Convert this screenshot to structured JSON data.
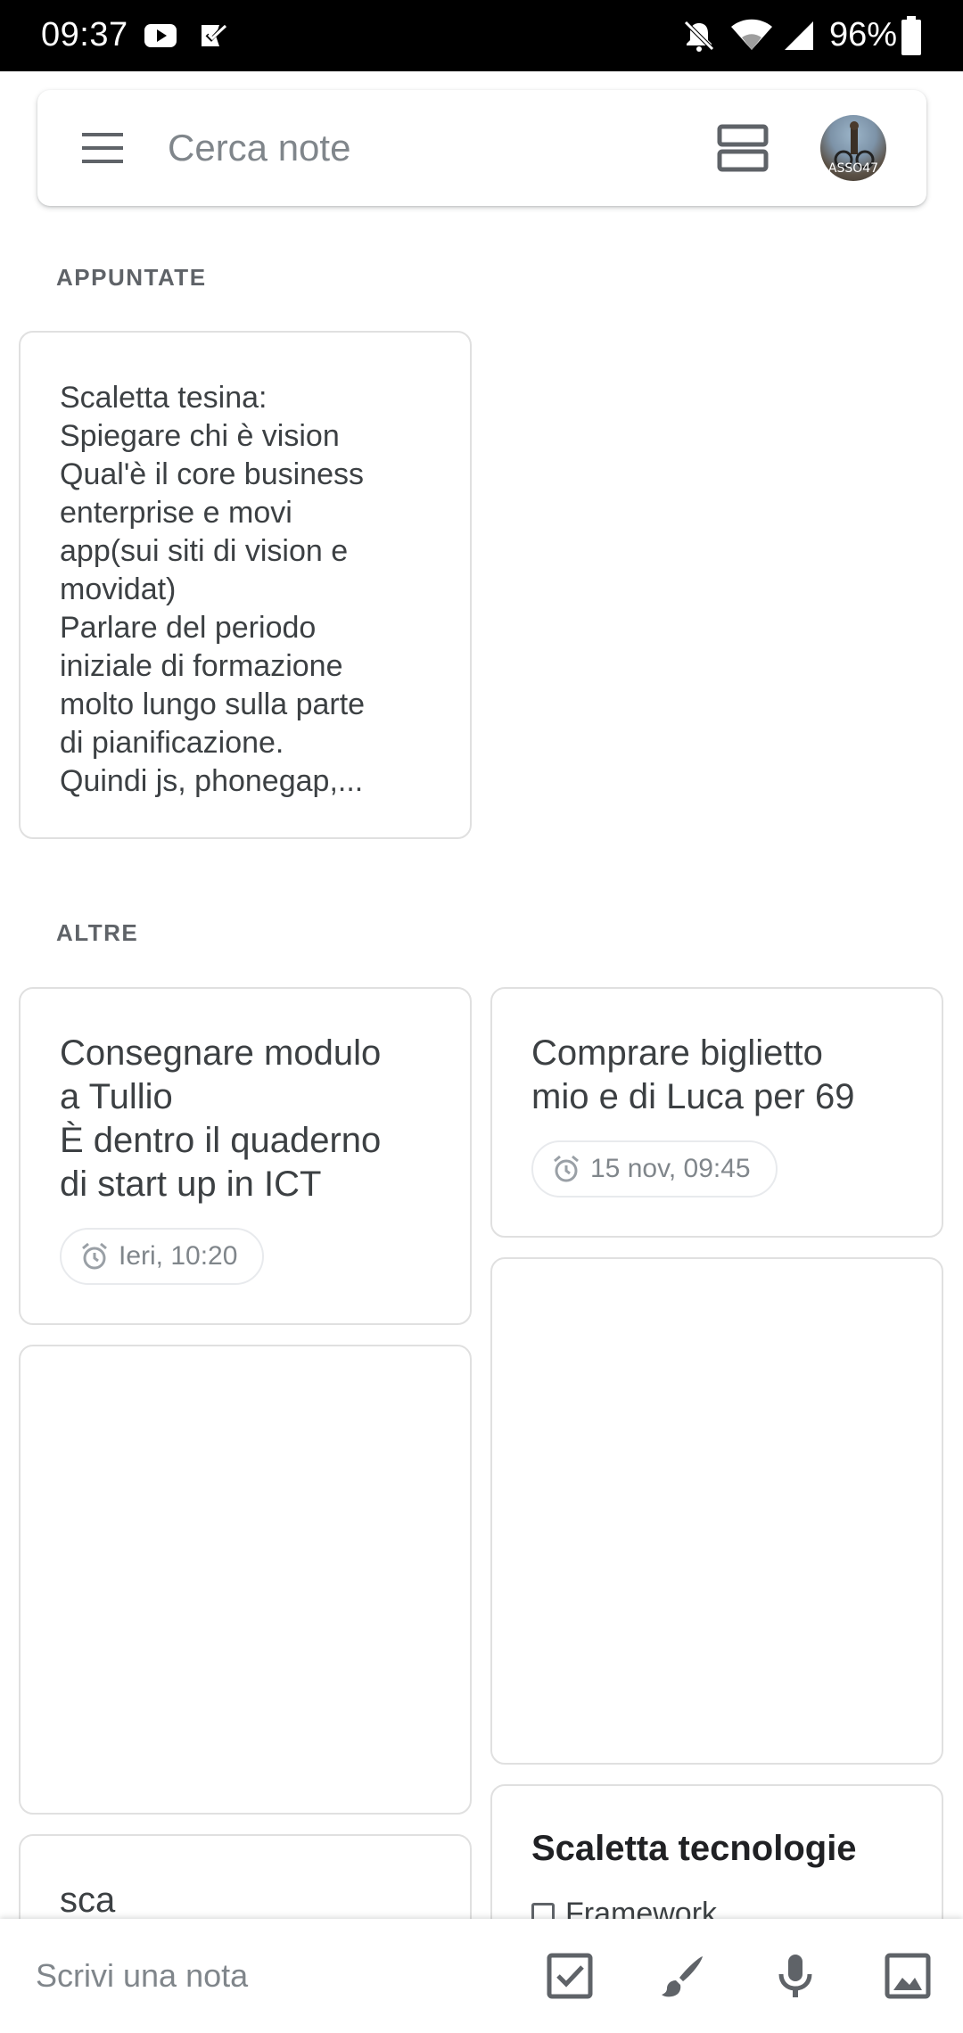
{
  "status_bar": {
    "time": "09:37",
    "battery": "96%",
    "icons": [
      "youtube-icon",
      "tasks-icon",
      "do-not-disturb-icon",
      "wifi-icon",
      "signal-icon",
      "battery-icon"
    ]
  },
  "search": {
    "placeholder": "Cerca note",
    "avatar_text": "ASSO47"
  },
  "sections": {
    "pinned": "APPUNTATE",
    "others": "ALTRE"
  },
  "notes": {
    "pinned_note": {
      "text": "Scaletta tesina:\nSpiegare chi è vision\nQual'è il core business\nenterprise e movi\napp(sui siti di vision e\nmovidat)\nParlare del periodo\niniziale di formazione\nmolto lungo sulla parte\ndi pianificazione.\nQuindi js, phonegap,..."
    },
    "note_modulo": {
      "text": "Consegnare modulo\na Tullio\nÈ dentro il quaderno\ndi start up in ICT",
      "reminder": "Ieri, 10:20"
    },
    "note_biglietto": {
      "text": "Comprare biglietto\nmio e di Luca per 69",
      "reminder": "15 nov, 09:45"
    },
    "note_sca": {
      "text": "sca"
    },
    "note_scaletta_tecnologie": {
      "title": "Scaletta tecnologie",
      "items": [
        "Framework"
      ]
    }
  },
  "bottom_bar": {
    "placeholder": "Scrivi una nota",
    "icons": [
      "checkbox-icon",
      "brush-icon",
      "mic-icon",
      "image-icon"
    ]
  },
  "colors": {
    "status_bar_bg": "#000000",
    "card_border": "#e0e0e0",
    "label_gray": "#5f6368"
  }
}
